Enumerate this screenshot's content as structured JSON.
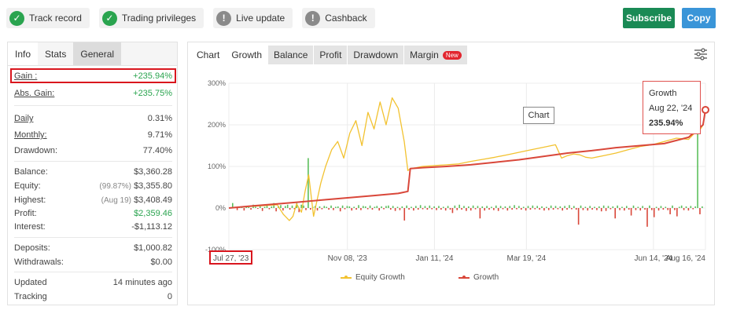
{
  "topbar": {
    "badges": [
      {
        "label": "Track record",
        "icon": "check-icon"
      },
      {
        "label": "Trading privileges",
        "icon": "check-icon"
      },
      {
        "label": "Live update",
        "icon": "exclamation-icon"
      },
      {
        "label": "Cashback",
        "icon": "exclamation-icon"
      }
    ],
    "subscribe_label": "Subscribe",
    "copy_label": "Copy"
  },
  "colors": {
    "green": "#2aa44f",
    "red": "#d9161e",
    "subscribe": "#1a8a55",
    "copy": "#3a95d8",
    "growth": "#d9473a",
    "equity": "#f2c230"
  },
  "left": {
    "tabs": [
      "Info",
      "Stats",
      "General"
    ],
    "stats": [
      {
        "label": "Gain :",
        "value": "+235.94%"
      },
      {
        "label": "Abs. Gain:",
        "value": "+235.75%"
      },
      {
        "label": "Daily",
        "value": "0.31%"
      },
      {
        "label": "Monthly:",
        "value": "9.71%"
      },
      {
        "label": "Drawdown:",
        "value": "77.40%"
      },
      {
        "label": "Balance:",
        "value": "$3,360.28"
      },
      {
        "label": "Equity:",
        "sub": "(99.87%)",
        "value": "$3,355.80"
      },
      {
        "label": "Highest:",
        "sub": "(Aug 19)",
        "value": "$3,408.49"
      },
      {
        "label": "Profit:",
        "value": "$2,359.46"
      },
      {
        "label": "Interest:",
        "value": "-$1,113.12"
      },
      {
        "label": "Deposits:",
        "value": "$1,000.82"
      },
      {
        "label": "Withdrawals:",
        "value": "$0.00"
      },
      {
        "label": "Updated",
        "value": "14 minutes ago"
      },
      {
        "label": "Tracking",
        "value": "0"
      }
    ]
  },
  "chart_tabs": {
    "labels": [
      "Chart",
      "Growth",
      "Balance",
      "Profit",
      "Drawdown",
      "Margin"
    ],
    "new_badge": "New"
  },
  "tooltip": {
    "title": "Growth",
    "date": "Aug 22, '24",
    "value": "235.94%"
  },
  "hover_label": "Chart",
  "chart_data": {
    "type": "line",
    "yticks": [
      "300%",
      "200%",
      "100%",
      "0%",
      "-100%"
    ],
    "xticks": [
      "Jul 27, '23",
      "Nov 08, '23",
      "Jan 11, '24",
      "Mar 19, '24",
      "Jun 14, '24",
      "Aug 16, '24"
    ],
    "ylim": [
      -100,
      300
    ],
    "series": [
      {
        "name": "Equity Growth",
        "x": [
          0,
          10,
          20,
          30,
          40,
          45,
          50,
          53,
          56,
          60,
          63,
          66,
          70,
          73,
          76,
          80,
          85,
          90,
          95,
          100,
          105,
          110,
          115,
          120,
          125,
          130,
          135,
          140,
          145,
          148,
          150,
          155,
          160,
          170,
          180,
          190,
          200,
          210,
          220,
          230,
          240,
          250,
          260,
          270,
          275,
          280,
          285,
          290,
          295,
          300,
          310,
          320,
          330,
          340,
          350,
          360,
          370,
          380,
          385,
          390,
          392,
          394
        ],
        "values": [
          0,
          2,
          4,
          6,
          8,
          -15,
          -30,
          -20,
          10,
          -10,
          40,
          80,
          -20,
          20,
          60,
          100,
          140,
          160,
          120,
          180,
          210,
          150,
          230,
          190,
          255,
          200,
          265,
          240,
          160,
          90,
          95,
          97,
          100,
          102,
          104,
          106,
          112,
          117,
          122,
          128,
          134,
          140,
          146,
          152,
          120,
          126,
          130,
          128,
          122,
          120,
          126,
          132,
          140,
          148,
          152,
          160,
          168,
          165,
          180,
          190,
          200,
          235.94
        ]
      },
      {
        "name": "Growth",
        "x": [
          0,
          20,
          40,
          60,
          80,
          100,
          120,
          140,
          148,
          150,
          160,
          180,
          200,
          220,
          240,
          260,
          280,
          300,
          320,
          340,
          360,
          380,
          392,
          394
        ],
        "values": [
          0,
          5,
          10,
          15,
          20,
          25,
          30,
          35,
          40,
          95,
          97,
          100,
          104,
          110,
          116,
          124,
          132,
          138,
          145,
          150,
          155,
          170,
          200,
          235.94
        ]
      }
    ],
    "bars_daily": [
      12,
      3,
      -5,
      2,
      4,
      -6,
      3,
      2,
      -4,
      8,
      3,
      -2,
      5,
      -7,
      3,
      6,
      -3,
      4,
      12,
      -8,
      5,
      7,
      -6,
      5,
      8,
      -4,
      6,
      -3,
      12,
      -10,
      8,
      6,
      -5,
      120,
      -4,
      3,
      5,
      -6,
      4,
      -3,
      5,
      3,
      -4,
      6,
      -5,
      3,
      4,
      -8,
      6,
      -3,
      5,
      4,
      -6,
      3,
      -4,
      7,
      -5,
      5,
      4,
      -3,
      6,
      -4,
      3,
      5,
      -6,
      4,
      -3,
      5,
      6,
      -4,
      5,
      -7,
      3,
      -5,
      4,
      -30,
      6,
      -4,
      3,
      -6,
      5,
      -4,
      7,
      -3,
      5,
      -4,
      6,
      -3,
      4,
      -5,
      5,
      -4,
      3,
      -6,
      5,
      -4,
      -12,
      6,
      -5,
      8,
      -4,
      5,
      -7,
      4,
      -6,
      6,
      -3,
      5,
      -25,
      4,
      -6,
      5,
      -4,
      3,
      -5,
      6,
      -7,
      5,
      -3,
      4,
      -6,
      5,
      -4,
      7,
      -3,
      5,
      -4,
      3,
      -6,
      5,
      -4,
      6,
      -3,
      5,
      -4,
      4,
      -6,
      3,
      -5,
      6,
      -4,
      5,
      -3,
      4,
      -6,
      5,
      -4,
      7,
      -3,
      5,
      -4,
      -40,
      6,
      -5,
      3,
      -6,
      5,
      -4,
      3,
      -5,
      4,
      -8,
      6,
      -7,
      5,
      -3,
      4,
      -25,
      6,
      -5,
      3,
      -6,
      5,
      -4,
      -18,
      6,
      -5,
      3,
      -6,
      5,
      -4,
      -45,
      6,
      -5,
      -22,
      3,
      -6,
      5,
      -4,
      3,
      -5,
      -15,
      6,
      -5,
      -20,
      3,
      6,
      -5,
      4,
      -6,
      5,
      -3,
      4,
      250,
      -15,
      4
    ]
  },
  "legend": [
    "Equity Growth",
    "Growth"
  ]
}
